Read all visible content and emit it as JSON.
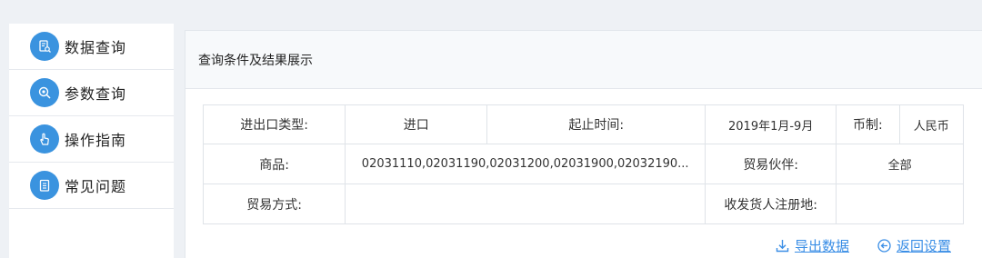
{
  "sidebar": {
    "items": [
      {
        "label": "数据查询",
        "icon": "document-search-icon"
      },
      {
        "label": "参数查询",
        "icon": "magnifier-icon"
      },
      {
        "label": "操作指南",
        "icon": "hand-pointer-icon"
      },
      {
        "label": "常见问题",
        "icon": "clipboard-icon"
      }
    ]
  },
  "panel": {
    "title": "查询条件及结果展示",
    "table": {
      "row1": {
        "ie_type_label": "进出口类型:",
        "ie_type_value": "进口",
        "period_label": "起止时间:",
        "period_value": "2019年1月-9月",
        "currency_label": "币制:",
        "currency_value": "人民币"
      },
      "row2": {
        "goods_label": "商品:",
        "goods_value": "02031110,02031190,02031200,02031900,02032190...",
        "partner_label": "贸易伙伴:",
        "partner_value": "全部"
      },
      "row3": {
        "trade_mode_label": "贸易方式:",
        "trade_mode_value": "",
        "consignee_label": "收发货人注册地:",
        "consignee_value": ""
      }
    },
    "actions": {
      "export_label": "导出数据",
      "back_label": "返回设置"
    }
  },
  "colors": {
    "accent": "#3a93df",
    "link": "#3a8ee6",
    "background": "#eef1f5"
  }
}
